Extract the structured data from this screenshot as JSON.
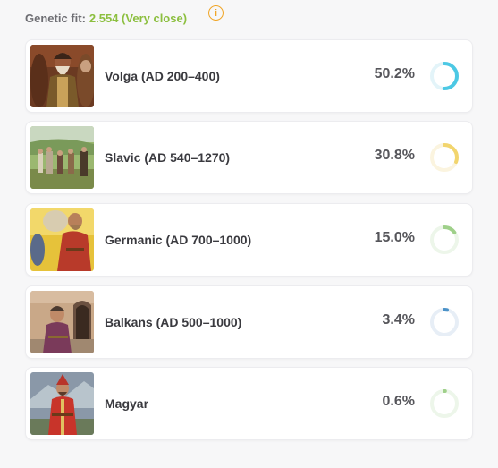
{
  "header": {
    "fit_label": "Genetic fit:",
    "fit_value": "2.554 (Very close)",
    "info_icon": "i"
  },
  "populations": [
    {
      "name": "Volga (AD 200–400)",
      "percent_label": "50.2%",
      "percent": 50.2,
      "color": "#4cc8e4",
      "track": "#e3f4f9",
      "thumb": "volga-warrior-portrait"
    },
    {
      "name": "Slavic (AD 540–1270)",
      "percent_label": "30.8%",
      "percent": 30.8,
      "color": "#f2d56e",
      "track": "#fbf4df",
      "thumb": "slavic-village-scene"
    },
    {
      "name": "Germanic (AD 700–1000)",
      "percent_label": "15.0%",
      "percent": 15.0,
      "color": "#9fd08a",
      "track": "#edf6ea",
      "thumb": "germanic-man-carrying-sack"
    },
    {
      "name": "Balkans (AD 500–1000)",
      "percent_label": "3.4%",
      "percent": 3.4,
      "color": "#4b92c8",
      "track": "#e7eef6",
      "thumb": "balkan-man-by-archway"
    },
    {
      "name": "Magyar",
      "percent_label": "0.6%",
      "percent": 0.6,
      "color": "#9fd08a",
      "track": "#edf6ea",
      "thumb": "magyar-warrior-red-coat"
    }
  ]
}
